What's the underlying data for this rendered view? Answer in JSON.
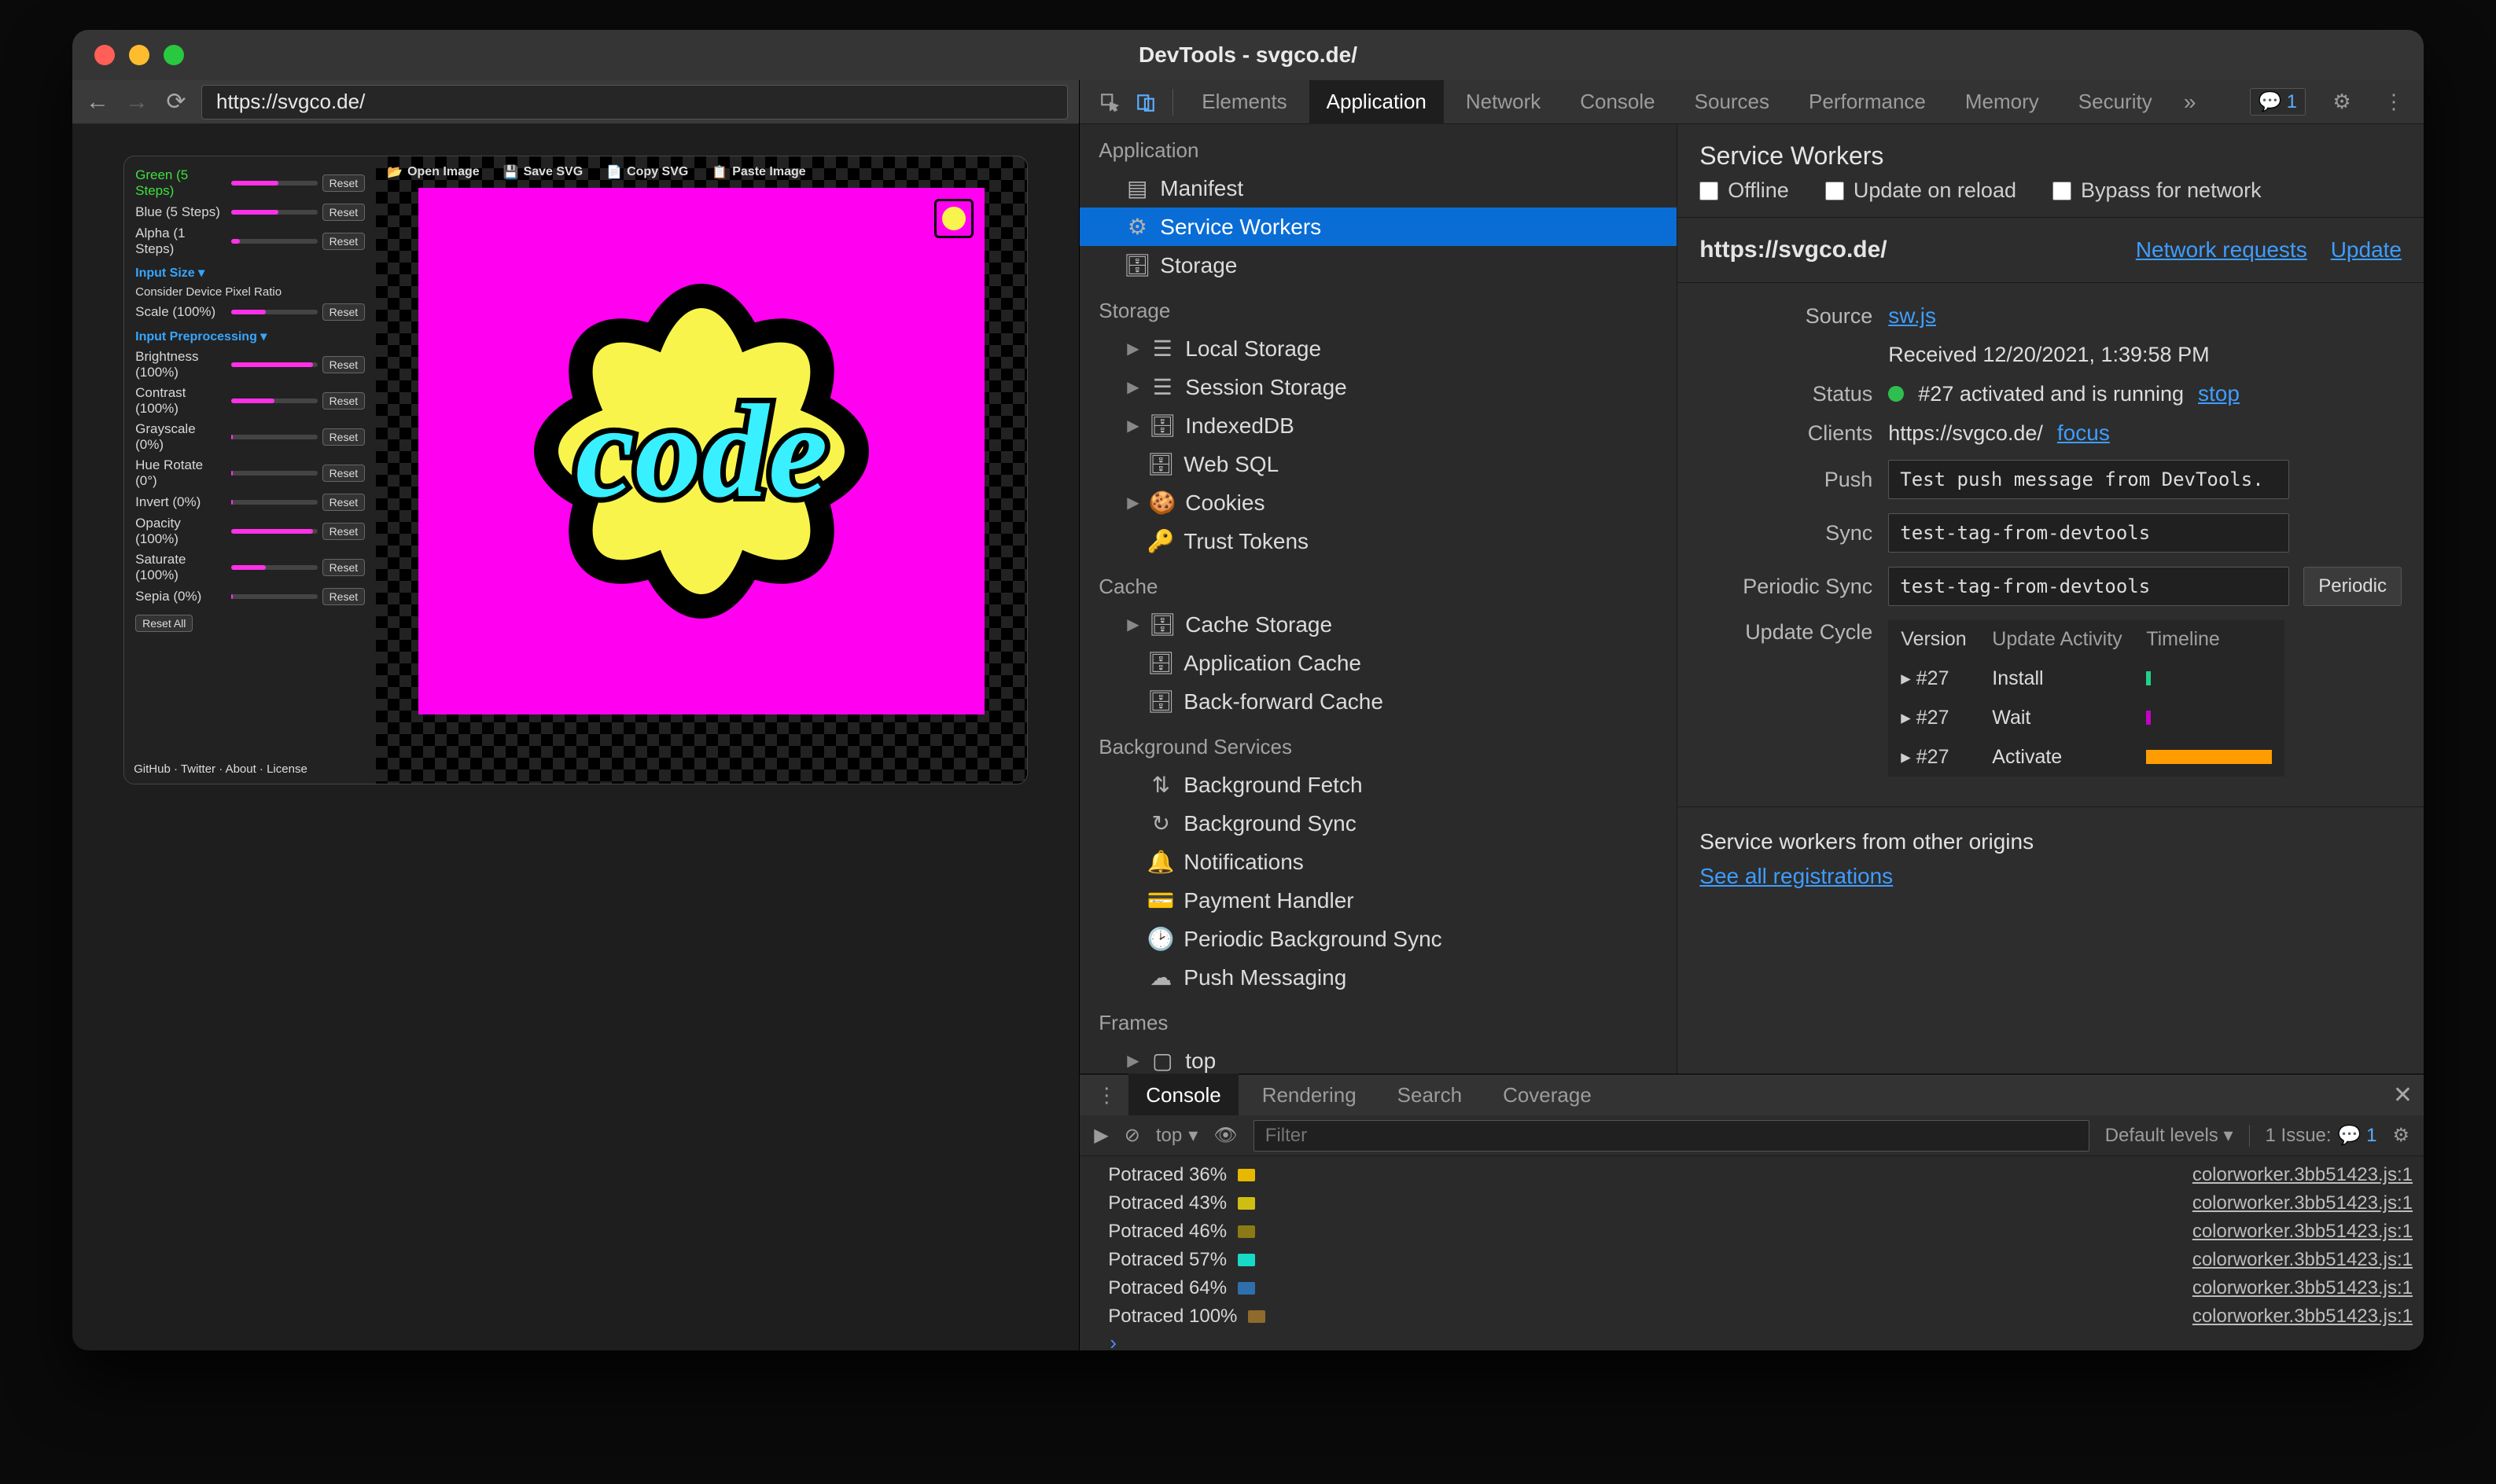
{
  "window": {
    "title": "DevTools - svgco.de/"
  },
  "addressbar": {
    "url": "https://svgco.de/"
  },
  "page": {
    "topIcons": [
      "Open Image",
      "Save SVG",
      "Copy SVG",
      "Paste Image"
    ],
    "sections": {
      "color": {
        "blue": "Blue (5 Steps)",
        "alpha": "Alpha (1 Steps)"
      },
      "inputSize": {
        "header": "Input Size ▾",
        "consider": "Consider Device Pixel Ratio",
        "scale": "Scale (100%)"
      },
      "prep": {
        "header": "Input Preprocessing ▾",
        "brightness": "Brightness (100%)",
        "contrast": "Contrast (100%)",
        "grayscale": "Grayscale (0%)",
        "hue": "Hue Rotate (0°)",
        "invert": "Invert (0%)",
        "opacity": "Opacity (100%)",
        "saturate": "Saturate (100%)",
        "sepia": "Sepia (0%)"
      },
      "reset": "Reset",
      "resetAll": "Reset All",
      "footer": "GitHub · Twitter · About · License"
    },
    "canvasWord": "code"
  },
  "devtools": {
    "tabs": [
      "Elements",
      "Application",
      "Network",
      "Console",
      "Sources",
      "Performance",
      "Memory",
      "Security"
    ],
    "activeTab": "Application",
    "issueCount": "1"
  },
  "appTree": {
    "application": {
      "label": "Application",
      "manifest": "Manifest",
      "sw": "Service Workers",
      "storage": "Storage"
    },
    "storage": {
      "label": "Storage",
      "local": "Local Storage",
      "session": "Session Storage",
      "idb": "IndexedDB",
      "websql": "Web SQL",
      "cookies": "Cookies",
      "trust": "Trust Tokens"
    },
    "cache": {
      "label": "Cache",
      "cs": "Cache Storage",
      "ac": "Application Cache",
      "bf": "Back-forward Cache"
    },
    "bg": {
      "label": "Background Services",
      "fetch": "Background Fetch",
      "sync": "Background Sync",
      "notif": "Notifications",
      "pay": "Payment Handler",
      "periodic": "Periodic Background Sync",
      "push": "Push Messaging"
    },
    "frames": {
      "label": "Frames",
      "top": "top"
    }
  },
  "sw": {
    "header": "Service Workers",
    "chk": {
      "offline": "Offline",
      "update": "Update on reload",
      "bypass": "Bypass for network"
    },
    "scope": "https://svgco.de/",
    "netreq": "Network requests",
    "update": "Update",
    "sourceLabel": "Source",
    "source": "sw.js",
    "received": "Received 12/20/2021, 1:39:58 PM",
    "statusLabel": "Status",
    "status": "#27 activated and is running",
    "stop": "stop",
    "clientsLabel": "Clients",
    "clients": "https://svgco.de/",
    "focus": "focus",
    "pushLabel": "Push",
    "push": "Test push message from DevTools.",
    "syncLabel": "Sync",
    "sync": "test-tag-from-devtools",
    "periodicLabel": "Periodic Sync",
    "periodic": "test-tag-from-devtools",
    "periodicBtn": "Periodic",
    "cycleLabel": "Update Cycle",
    "cycle": {
      "c1": "Version",
      "c2": "Update Activity",
      "c3": "Timeline",
      "v": "#27",
      "install": "Install",
      "wait": "Wait",
      "activate": "Activate"
    },
    "otherHdr": "Service workers from other origins",
    "seeAll": "See all registrations"
  },
  "drawer": {
    "tabs": [
      "Console",
      "Rendering",
      "Search",
      "Coverage"
    ],
    "context": "top",
    "filterPlaceholder": "Filter",
    "levels": "Default levels ▾",
    "issue": "1 Issue:",
    "issueN": "1",
    "logs": [
      {
        "msg": "Potraced 36%",
        "color": "#e6b800",
        "src": "colorworker.3bb51423.js:1"
      },
      {
        "msg": "Potraced 43%",
        "color": "#cebe12",
        "src": "colorworker.3bb51423.js:1"
      },
      {
        "msg": "Potraced 46%",
        "color": "#8b7a16",
        "src": "colorworker.3bb51423.js:1"
      },
      {
        "msg": "Potraced 57%",
        "color": "#18d9c8",
        "src": "colorworker.3bb51423.js:1"
      },
      {
        "msg": "Potraced 64%",
        "color": "#2f6fae",
        "src": "colorworker.3bb51423.js:1"
      },
      {
        "msg": "Potraced 100%",
        "color": "#8e6b2a",
        "src": "colorworker.3bb51423.js:1"
      }
    ]
  }
}
